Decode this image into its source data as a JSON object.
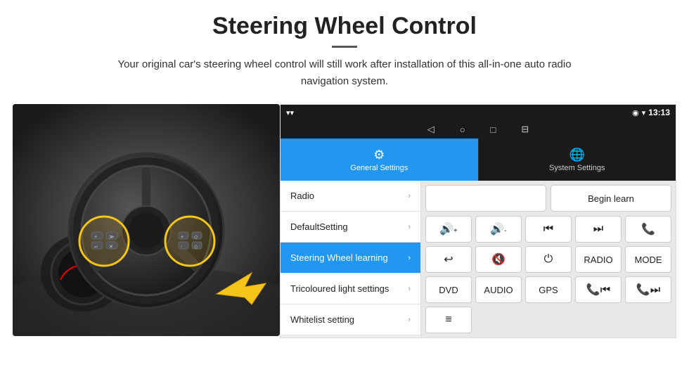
{
  "header": {
    "title": "Steering Wheel Control",
    "subtitle": "Your original car's steering wheel control will still work after installation of this all-in-one auto radio navigation system."
  },
  "status_bar": {
    "wifi_icon": "▾",
    "signal_icon": "▾",
    "location_icon": "◉",
    "time": "13:13"
  },
  "nav_bar": {
    "back_icon": "◁",
    "home_icon": "○",
    "recent_icon": "□",
    "cast_icon": "⊟"
  },
  "tabs": [
    {
      "id": "general",
      "label": "General Settings",
      "icon": "⚙",
      "active": true
    },
    {
      "id": "system",
      "label": "System Settings",
      "icon": "🌐",
      "active": false
    }
  ],
  "menu_items": [
    {
      "id": "radio",
      "label": "Radio",
      "active": false
    },
    {
      "id": "default",
      "label": "DefaultSetting",
      "active": false
    },
    {
      "id": "steering",
      "label": "Steering Wheel learning",
      "active": true
    },
    {
      "id": "tricolour",
      "label": "Tricoloured light settings",
      "active": false
    },
    {
      "id": "whitelist",
      "label": "Whitelist setting",
      "active": false
    }
  ],
  "controls": {
    "begin_learn": "Begin learn",
    "row1": [
      {
        "label": "🔊+",
        "id": "vol-up"
      },
      {
        "label": "🔊-",
        "id": "vol-down"
      },
      {
        "label": "⏮",
        "id": "prev"
      },
      {
        "label": "⏭",
        "id": "next"
      },
      {
        "label": "📞",
        "id": "call"
      }
    ],
    "row2": [
      {
        "label": "↩",
        "id": "back"
      },
      {
        "label": "🔇",
        "id": "mute"
      },
      {
        "label": "⏻",
        "id": "power"
      },
      {
        "label": "RADIO",
        "id": "radio-btn"
      },
      {
        "label": "MODE",
        "id": "mode-btn"
      }
    ],
    "row3": [
      {
        "label": "DVD",
        "id": "dvd"
      },
      {
        "label": "AUDIO",
        "id": "audio"
      },
      {
        "label": "GPS",
        "id": "gps"
      },
      {
        "label": "📞⏮",
        "id": "call-prev"
      },
      {
        "label": "📞⏭",
        "id": "call-next"
      }
    ],
    "row4": [
      {
        "label": "≡",
        "id": "menu-icon"
      }
    ]
  }
}
